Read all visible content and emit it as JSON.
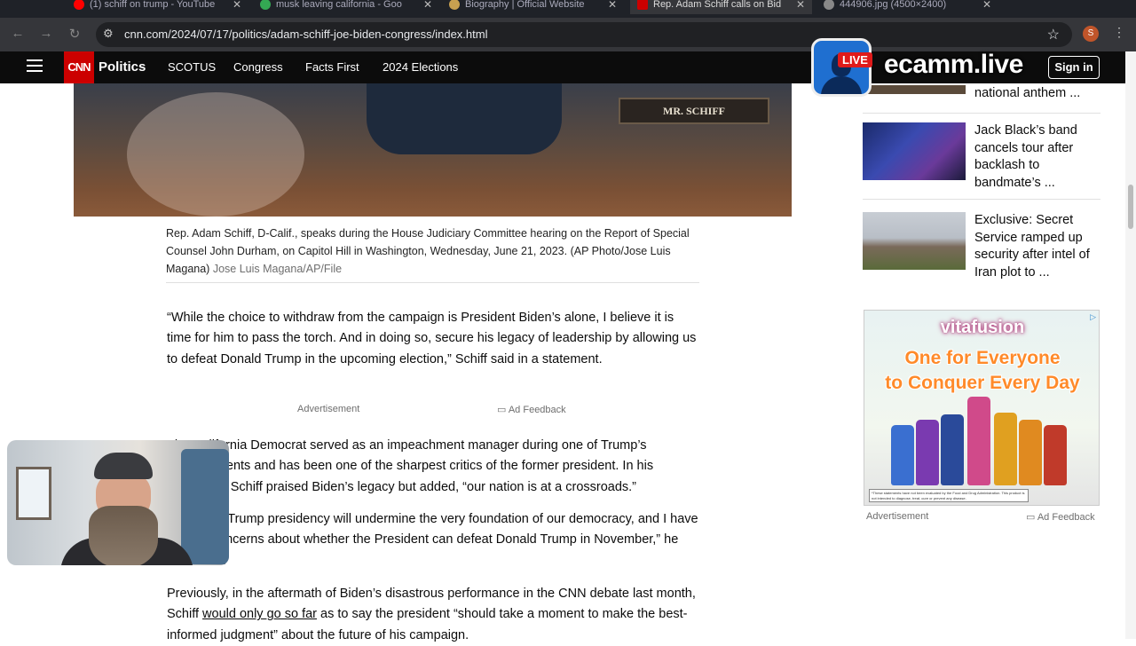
{
  "browser": {
    "tabs": [
      {
        "title": "(1) schiff on trump - YouTube",
        "favicon_color": "#ff0000"
      },
      {
        "title": "musk leaving california - Goo",
        "favicon_color": "#34a853"
      },
      {
        "title": "Biography | Official Website",
        "favicon_color": "#c8a050"
      },
      {
        "title": "Rep. Adam Schiff calls on Bid",
        "favicon_color": "#cc0000",
        "active": true
      },
      {
        "title": "444906.jpg (4500×2400)",
        "favicon_color": "#888888"
      }
    ],
    "url": "cnn.com/2024/07/17/politics/adam-schiff-joe-biden-congress/index.html",
    "profile_initial": "S"
  },
  "cnn_nav": {
    "logo": "CNN",
    "section": "Politics",
    "links": [
      "SCOTUS",
      "Congress",
      "Facts First",
      "2024 Elections"
    ],
    "signin": "Sign in"
  },
  "hero": {
    "nameplate": "MR. SCHIFF"
  },
  "caption": {
    "text": "Rep. Adam Schiff, D-Calif., speaks during the House Judiciary Committee hearing on the Report of Special Counsel John Durham, on Capitol Hill in Washington, Wednesday, June 21, 2023. (AP Photo/Jose Luis Magana)",
    "credit": "Jose Luis Magana/AP/File"
  },
  "article": {
    "p1": "“While the choice to withdraw from the campaign is President Biden’s alone, I believe it is time for him to pass the torch. And in doing so, secure his legacy of leadership by allowing us to defeat Donald Trump in the upcoming election,” Schiff said in a statement.",
    "ad_label": "Advertisement",
    "ad_feedback": "Ad Feedback",
    "p2": "The California Democrat served as an impeachment manager during one of Trump’s impeachments and has been one of the sharpest critics of the former president. In his statement, Schiff praised Biden’s legacy but added, “our nation is at a crossroads.”",
    "p3": "“A second Trump presidency will undermine the very foundation of our democracy, and I have serious concerns about whether the President can defeat Donald Trump in November,” he continued.",
    "p4_before": "Previously, in the aftermath of Biden’s disastrous performance in the CNN debate last month, Schiff ",
    "p4_link": "would only go so far",
    "p4_after": " as to say the president “should take a moment to make the best-informed judgment” about the future of his campaign."
  },
  "sidebar": {
    "items": [
      {
        "headline": "national anthem ..."
      },
      {
        "headline": "Jack Black’s band cancels tour after backlash to bandmate’s ..."
      },
      {
        "headline": "Exclusive: Secret Service ramped up security after intel of Iran plot to ..."
      }
    ],
    "ad": {
      "brand": "vitafusion",
      "tagline_1": "One for Everyone",
      "tagline_2": "to Conquer Every Day",
      "disclaimer": "*These statements have not been evaluated by the Food and Drug Administration. This product is not intended to diagnose, treat, cure or prevent any disease.",
      "label": "Advertisement",
      "feedback": "Ad Feedback"
    }
  },
  "overlay": {
    "live_badge": "LIVE",
    "brand": "ecamm.live"
  }
}
